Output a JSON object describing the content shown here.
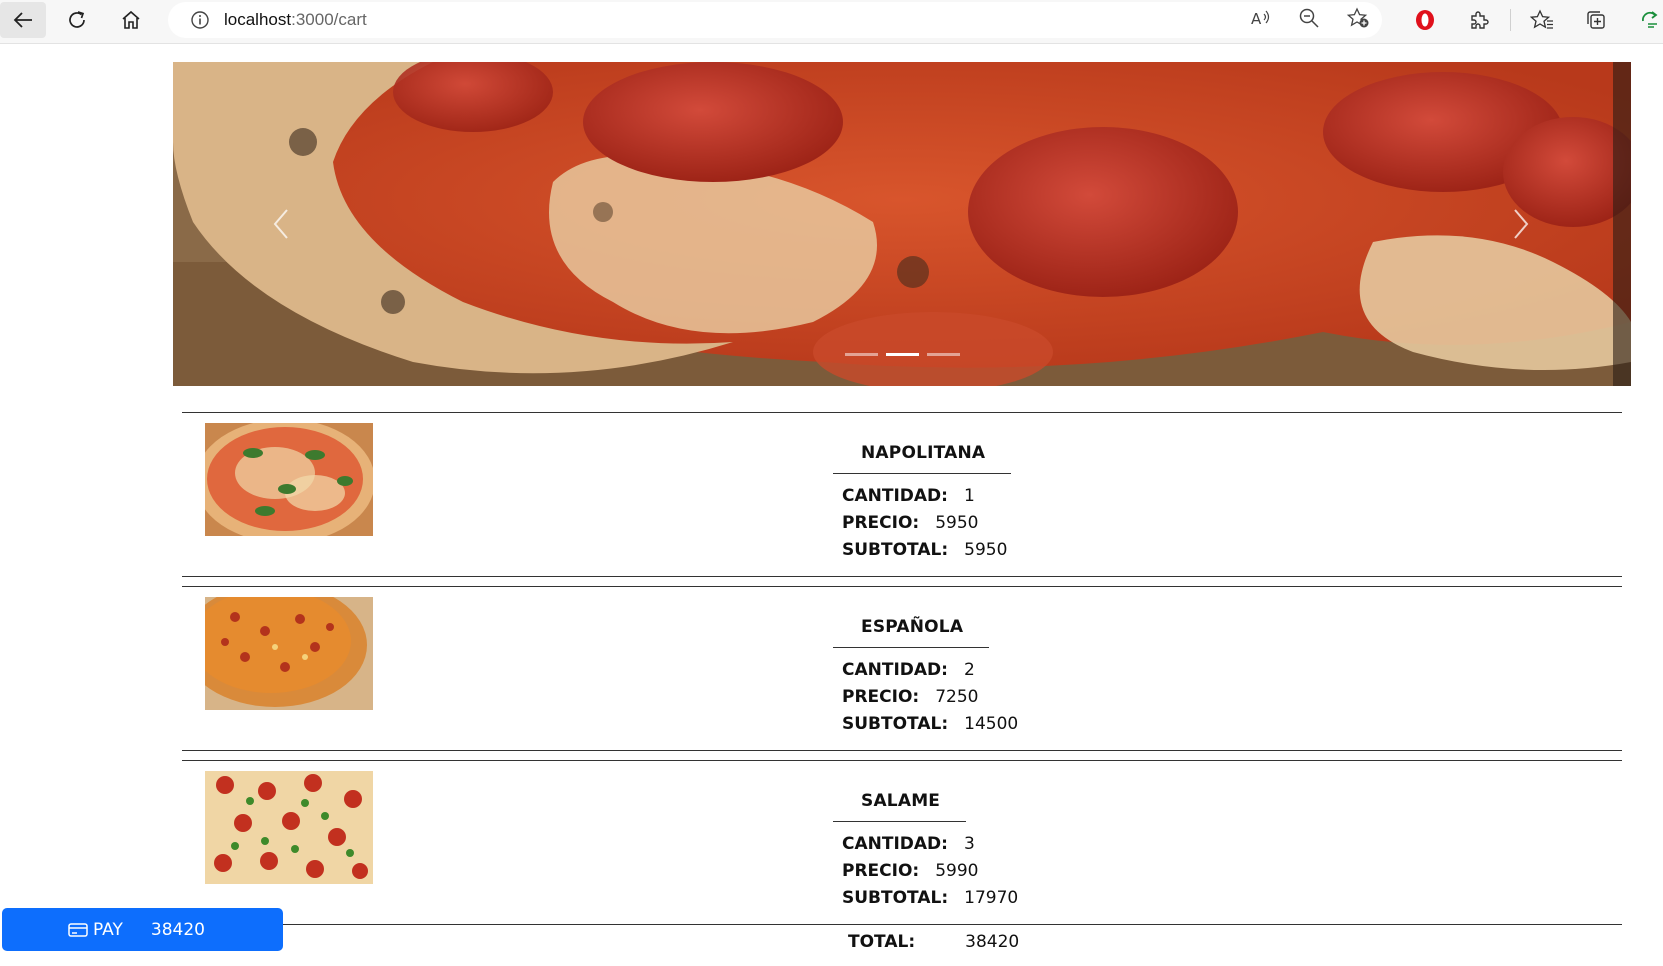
{
  "browser": {
    "url_host": "localhost",
    "url_path": ":3000/cart"
  },
  "carousel": {
    "slides": 3,
    "active_index": 1
  },
  "cart": {
    "items": [
      {
        "name": "NAPOLITANA",
        "cantidad_label": "CANTIDAD:",
        "cantidad": "1",
        "precio_label": "PRECIO:",
        "precio": "5950",
        "subtotal_label": "SUBTOTAL:",
        "subtotal": "5950"
      },
      {
        "name": "ESPAÑOLA",
        "cantidad_label": "CANTIDAD:",
        "cantidad": "2",
        "precio_label": "PRECIO:",
        "precio": "7250",
        "subtotal_label": "SUBTOTAL:",
        "subtotal": "14500"
      },
      {
        "name": "SALAME",
        "cantidad_label": "CANTIDAD:",
        "cantidad": "3",
        "precio_label": "PRECIO:",
        "precio": "5990",
        "subtotal_label": "SUBTOTAL:",
        "subtotal": "17970"
      }
    ],
    "total_label": "TOTAL:",
    "total_value": "38420"
  },
  "pay_button": {
    "label": "PAY",
    "amount": "38420",
    "icon": "credit-card-icon",
    "color": "#0d6efd"
  }
}
